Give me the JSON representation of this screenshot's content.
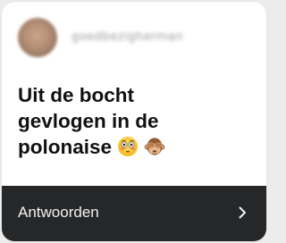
{
  "card": {
    "username": "goedbezigherman",
    "message": "Uit de bocht\ngevlogen in de\npolonaise",
    "emojis": [
      "flushed-face-emoji",
      "see-no-evil-monkey-emoji"
    ]
  },
  "reply": {
    "label": "Antwoorden",
    "icon": "chevron-right-icon"
  },
  "colors": {
    "card_background": "#ffffff",
    "footer_background": "#262729",
    "text": "#111111",
    "footer_text": "#f3f3f3"
  }
}
